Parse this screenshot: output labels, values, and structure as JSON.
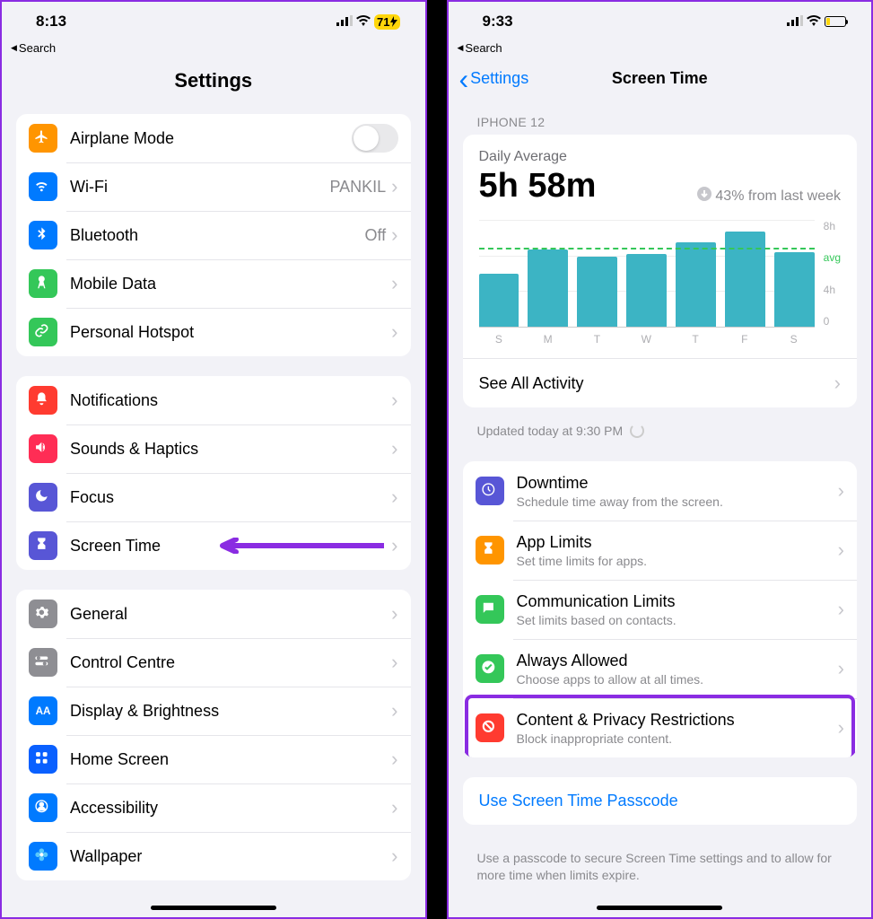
{
  "left": {
    "time": "8:13",
    "battery": "71",
    "back": "Search",
    "title": "Settings",
    "g1": [
      {
        "icon": "airplane",
        "bg": "bg-orange",
        "label": "Airplane Mode",
        "toggle": true
      },
      {
        "icon": "wifi",
        "bg": "bg-blue",
        "label": "Wi-Fi",
        "value": "PANKIL"
      },
      {
        "icon": "bluetooth",
        "bg": "bg-blue",
        "label": "Bluetooth",
        "value": "Off"
      },
      {
        "icon": "antenna",
        "bg": "bg-green",
        "label": "Mobile Data"
      },
      {
        "icon": "link",
        "bg": "bg-green",
        "label": "Personal Hotspot"
      }
    ],
    "g2": [
      {
        "icon": "bell",
        "bg": "bg-red",
        "label": "Notifications"
      },
      {
        "icon": "sound",
        "bg": "bg-pink",
        "label": "Sounds & Haptics"
      },
      {
        "icon": "moon",
        "bg": "bg-indigo",
        "label": "Focus"
      },
      {
        "icon": "hourglass",
        "bg": "bg-indigo",
        "label": "Screen Time",
        "arrow": true
      }
    ],
    "g3": [
      {
        "icon": "gear",
        "bg": "bg-gray",
        "label": "General"
      },
      {
        "icon": "switches",
        "bg": "bg-gray",
        "label": "Control Centre"
      },
      {
        "icon": "aa",
        "bg": "bg-blue",
        "label": "Display & Brightness"
      },
      {
        "icon": "grid",
        "bg": "bg-darkblue",
        "label": "Home Screen"
      },
      {
        "icon": "person",
        "bg": "bg-blue",
        "label": "Accessibility"
      },
      {
        "icon": "flower",
        "bg": "bg-blue",
        "label": "Wallpaper"
      }
    ]
  },
  "right": {
    "time": "9:33",
    "back": "Search",
    "navBack": "Settings",
    "title": "Screen Time",
    "device": "IPHONE 12",
    "dailyLabel": "Daily Average",
    "dailyValue": "5h 58m",
    "trend": "43% from last week",
    "seeAll": "See All Activity",
    "updated": "Updated today at 9:30 PM",
    "options": [
      {
        "icon": "clock",
        "bg": "bg-indigo",
        "title": "Downtime",
        "sub": "Schedule time away from the screen."
      },
      {
        "icon": "hourglass",
        "bg": "bg-orange",
        "title": "App Limits",
        "sub": "Set time limits for apps."
      },
      {
        "icon": "chat",
        "bg": "bg-green",
        "title": "Communication Limits",
        "sub": "Set limits based on contacts."
      },
      {
        "icon": "check",
        "bg": "bg-green",
        "title": "Always Allowed",
        "sub": "Choose apps to allow at all times."
      },
      {
        "icon": "nosign",
        "bg": "bg-red",
        "title": "Content & Privacy Restrictions",
        "sub": "Block inappropriate content.",
        "highlight": true
      }
    ],
    "passcode": "Use Screen Time Passcode",
    "footer": "Use a passcode to secure Screen Time settings and to allow for more time when limits expire."
  },
  "chart_data": {
    "type": "bar",
    "categories": [
      "S",
      "M",
      "T",
      "W",
      "T",
      "F",
      "S"
    ],
    "values": [
      4.0,
      5.8,
      5.3,
      5.5,
      6.4,
      7.2,
      5.6
    ],
    "avg": 5.97,
    "ylabels": [
      "8h",
      "avg",
      "4h",
      "0"
    ],
    "ylim": [
      0,
      8
    ],
    "title": "Daily Average",
    "xlabel": "",
    "ylabel": ""
  }
}
